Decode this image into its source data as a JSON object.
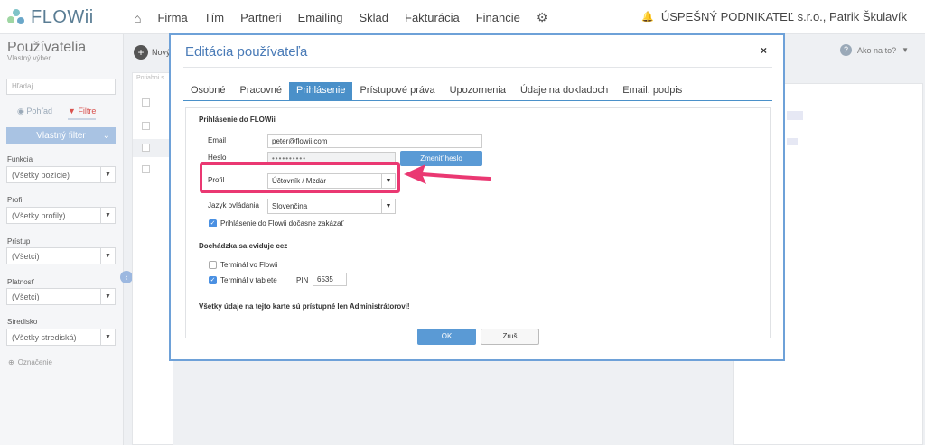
{
  "app": {
    "brand": "FLOWii",
    "nav": [
      "Firma",
      "Tím",
      "Partneri",
      "Emailing",
      "Sklad",
      "Fakturácia",
      "Financie"
    ],
    "company": "ÚSPEŠNÝ PODNIKATEĽ s.r.o., Patrik Škulavík"
  },
  "sidebar": {
    "title": "Používatelia",
    "subtitle": "Vlastný výber",
    "search_placeholder": "Hľadaj...",
    "tab_view": "Pohľad",
    "tab_filters": "Filtre",
    "custom_filter": "Vlastný filter",
    "filters": [
      {
        "label": "Funkcia",
        "value": "(Všetky pozície)"
      },
      {
        "label": "Profil",
        "value": "(Všetky profily)"
      },
      {
        "label": "Prístup",
        "value": "(Všetci)"
      },
      {
        "label": "Platnosť",
        "value": "(Všetci)"
      },
      {
        "label": "Stredisko",
        "value": "(Všetky strediská)"
      }
    ],
    "tag_label": "Označenie"
  },
  "main": {
    "new_label": "Nový",
    "list_header": "Potiahni s",
    "help_label": "Ako na to?"
  },
  "modal": {
    "title": "Editácia používateľa",
    "close": "×",
    "tabs": [
      "Osobné",
      "Pracovné",
      "Prihlásenie",
      "Prístupové práva",
      "Upozornenia",
      "Údaje na dokladoch",
      "Email. podpis"
    ],
    "active_tab": "Prihlásenie",
    "login_section": "Prihlásenie do FLOWii",
    "email_label": "Email",
    "email_value": "peter@flowii.com",
    "password_label": "Heslo",
    "password_value": "••••••••••",
    "change_password": "Zmeniť heslo",
    "profile_label": "Profil",
    "profile_value": "Účtovník / Mzdár",
    "language_label": "Jazyk ovládania",
    "language_value": "Slovenčina",
    "disable_login_label": "Prihlásenie do Flowii dočasne zakázať",
    "disable_login_checked": true,
    "attendance_section": "Dochádzka sa eviduje cez",
    "terminal_flowii": "Terminál vo Flowii",
    "terminal_flowii_checked": false,
    "terminal_tablet": "Terminál v tablete",
    "terminal_tablet_checked": true,
    "pin_label": "PIN",
    "pin_value": "6535",
    "admin_note": "Všetky údaje na tejto karte sú prístupné len Administrátorovi!",
    "ok": "OK",
    "cancel": "Zruš"
  },
  "colors": {
    "accent": "#4a90c9",
    "highlight": "#ea3872"
  }
}
